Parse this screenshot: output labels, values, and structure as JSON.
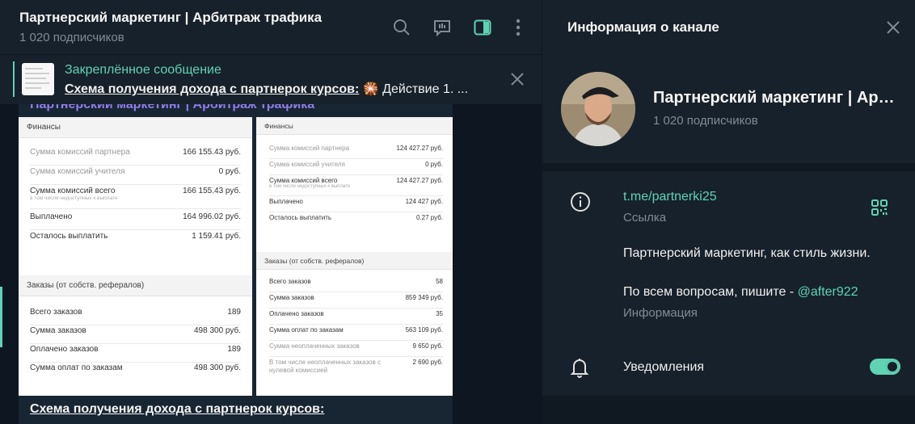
{
  "chat": {
    "title": "Партнерский маркетинг | Арбитраж трафика",
    "subscribers": "1 020 подписчиков",
    "pinned": {
      "title": "Закреплённое сообщение",
      "link_text": "Схема получения дохода с партнерок курсов:",
      "rest_text": " 🎇 Действие 1. ..."
    },
    "message": {
      "header": "Партнерский маркетинг | Арбитраж трафика",
      "caption": "Схема получения дохода с партнерок курсов:",
      "screenshot_a": {
        "finance_title": "Финансы",
        "rows": [
          {
            "label": "Сумма комиссий партнера",
            "value": "166 155.43 руб.",
            "dim": true
          },
          {
            "label": "Сумма комиссий учителя",
            "value": "0 руб.",
            "dim": true
          },
          {
            "label": "Сумма комиссий всего",
            "sub": "в том числе недоступных к выплате",
            "value": "166 155.43 руб.",
            "dim": false
          },
          {
            "label": "Выплачено",
            "value": "164 996.02 руб.",
            "dim": false
          },
          {
            "label": "Осталось выплатить",
            "value": "1 159.41 руб.",
            "dim": false
          }
        ],
        "orders_title": "Заказы (от собств. рефералов)",
        "orders": [
          {
            "label": "Всего заказов",
            "value": "189"
          },
          {
            "label": "Сумма заказов",
            "value": "498 300 руб."
          },
          {
            "label": "Оплачено заказов",
            "value": "189"
          },
          {
            "label": "Сумма оплат по заказам",
            "value": "498 300 руб."
          }
        ]
      },
      "screenshot_b": {
        "finance_title": "Финансы",
        "rows": [
          {
            "label": "Сумма комиссий партнера",
            "value": "124 427.27 руб.",
            "dim": true
          },
          {
            "label": "Сумма комиссий учителя",
            "value": "0 руб.",
            "dim": true
          },
          {
            "label": "Сумма комиссий всего",
            "sub": "в том числе недоступных к выплате",
            "value": "124 427.27 руб.",
            "dim": false
          },
          {
            "label": "Выплачено",
            "value": "124 427 руб.",
            "dim": false
          },
          {
            "label": "Осталось выплатить",
            "value": "0.27 руб.",
            "dim": false
          }
        ],
        "orders_title": "Заказы (от собств. рефералов)",
        "orders": [
          {
            "label": "Всего заказов",
            "value": "58"
          },
          {
            "label": "Сумма заказов",
            "value": "859 349 руб."
          },
          {
            "label": "Оплачено заказов",
            "value": "35"
          },
          {
            "label": "Сумма оплат по заказам",
            "value": "563 109 руб."
          },
          {
            "label": "Сумма неоплаченных заказов",
            "value": "9 650 руб."
          },
          {
            "label": "В том числе неоплаченных заказов с нулевой комиссией",
            "value": "2 690 руб."
          }
        ]
      }
    }
  },
  "panel": {
    "title": "Информация о канале",
    "channel_name": "Партнерский маркетинг | Арбитраж трафика",
    "subscribers": "1 020 подписчиков",
    "link": "t.me/partnerki25",
    "link_label": "Ссылка",
    "description_line1": "Партнерский маркетинг, как стиль жизни.",
    "description_line2": "По всем вопросам, пишите - ",
    "mention": "@after922",
    "description_label": "Информация",
    "notifications_label": "Уведомления",
    "notifications_on": true
  },
  "colors": {
    "accent": "#5fd3b4",
    "panel_bg": "#17212b",
    "chat_bg": "#0e1621",
    "header_purple": "#8f7ee8"
  }
}
